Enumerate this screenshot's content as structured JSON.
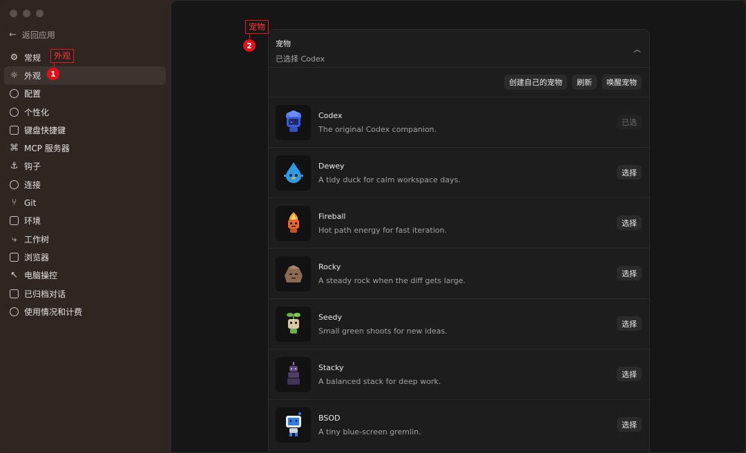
{
  "sidebar": {
    "back_label": "返回应用",
    "items": [
      {
        "label": "常规",
        "icon": "gear-icon",
        "active": false
      },
      {
        "label": "外观",
        "icon": "sun-icon",
        "active": true
      },
      {
        "label": "配置",
        "icon": "shield-icon",
        "active": false
      },
      {
        "label": "个性化",
        "icon": "smile-icon",
        "active": false
      },
      {
        "label": "键盘快捷键",
        "icon": "keyboard-icon",
        "active": false
      },
      {
        "label": "MCP 服务器",
        "icon": "mcp-icon",
        "active": false
      },
      {
        "label": "钩子",
        "icon": "anchor-icon",
        "active": false
      },
      {
        "label": "连接",
        "icon": "globe-icon",
        "active": false
      },
      {
        "label": "Git",
        "icon": "git-branch-icon",
        "active": false
      },
      {
        "label": "环境",
        "icon": "monitor-icon",
        "active": false
      },
      {
        "label": "工作树",
        "icon": "worktree-icon",
        "active": false
      },
      {
        "label": "浏览器",
        "icon": "browser-icon",
        "active": false
      },
      {
        "label": "电脑操控",
        "icon": "cursor-click-icon",
        "active": false
      },
      {
        "label": "已归档对话",
        "icon": "archive-icon",
        "active": false
      },
      {
        "label": "使用情况和计费",
        "icon": "gauge-icon",
        "active": false
      }
    ]
  },
  "annotations": {
    "box1": "外观",
    "dot1": "1",
    "box2": "宠物",
    "dot2": "2"
  },
  "panel": {
    "title": "宠物",
    "subtitle": "已选择 Codex",
    "toolbar": {
      "create": "创建自己的宠物",
      "refresh": "刷新",
      "wake": "唤醒宠物"
    },
    "pets": [
      {
        "name": "Codex",
        "desc": "The original Codex companion.",
        "button": "已选",
        "selected": true
      },
      {
        "name": "Dewey",
        "desc": "A tidy duck for calm workspace days.",
        "button": "选择",
        "selected": false
      },
      {
        "name": "Fireball",
        "desc": "Hot path energy for fast iteration.",
        "button": "选择",
        "selected": false
      },
      {
        "name": "Rocky",
        "desc": "A steady rock when the diff gets large.",
        "button": "选择",
        "selected": false
      },
      {
        "name": "Seedy",
        "desc": "Small green shoots for new ideas.",
        "button": "选择",
        "selected": false
      },
      {
        "name": "Stacky",
        "desc": "A balanced stack for deep work.",
        "button": "选择",
        "selected": false
      },
      {
        "name": "BSOD",
        "desc": "A tiny blue-screen gremlin.",
        "button": "选择",
        "selected": false
      }
    ]
  },
  "colors": {
    "accent_annotation": "#e3101a",
    "codex_blue": "#3b5bdb",
    "dewey_blue": "#2f9be6",
    "fireball_orange": "#e8692c",
    "rocky_brown": "#8a6a52",
    "seedy_green": "#6bb04a",
    "stacky_purple": "#5d4a7a",
    "bsod_blue": "#2f7de0"
  }
}
